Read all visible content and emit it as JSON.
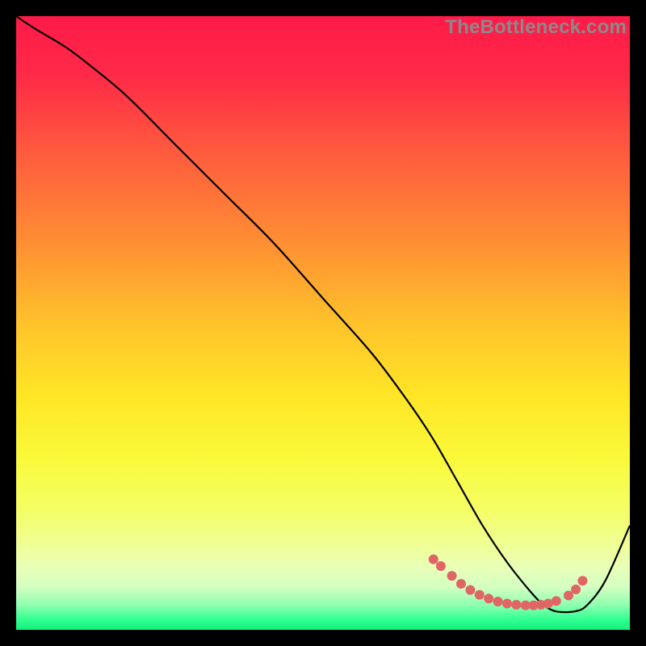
{
  "watermark": "TheBottleneck.com",
  "colors": {
    "background": "#000000",
    "gradient_stops": [
      {
        "offset": 0.0,
        "color": "#ff1a49"
      },
      {
        "offset": 0.1,
        "color": "#ff2b47"
      },
      {
        "offset": 0.22,
        "color": "#ff5a3e"
      },
      {
        "offset": 0.36,
        "color": "#ff8b34"
      },
      {
        "offset": 0.5,
        "color": "#ffc22a"
      },
      {
        "offset": 0.62,
        "color": "#ffe626"
      },
      {
        "offset": 0.72,
        "color": "#f9f93a"
      },
      {
        "offset": 0.8,
        "color": "#f5ff62"
      },
      {
        "offset": 0.86,
        "color": "#f0ff94"
      },
      {
        "offset": 0.9,
        "color": "#e8ffb9"
      },
      {
        "offset": 0.93,
        "color": "#d4ffc1"
      },
      {
        "offset": 0.96,
        "color": "#8dffaf"
      },
      {
        "offset": 0.985,
        "color": "#2bff8f"
      },
      {
        "offset": 1.0,
        "color": "#14f07e"
      }
    ],
    "curve": "#000000",
    "markers": "#e06666"
  },
  "chart_data": {
    "type": "line",
    "title": "",
    "xlabel": "",
    "ylabel": "",
    "xlim": [
      0,
      100
    ],
    "ylim": [
      0,
      100
    ],
    "series": [
      {
        "name": "bottleneck-curve",
        "x": [
          0,
          3,
          8,
          12,
          18,
          26,
          34,
          42,
          50,
          58,
          64,
          68,
          72,
          76,
          80,
          84,
          86,
          88,
          91,
          93,
          96,
          100
        ],
        "y": [
          100,
          98,
          95,
          92,
          87,
          79,
          71,
          63,
          54,
          45,
          37,
          31,
          24,
          17,
          11,
          6,
          4,
          3,
          3,
          4,
          8,
          17
        ]
      }
    ],
    "markers": {
      "name": "highlight-dots",
      "points": [
        {
          "x": 68.0,
          "y": 11.5
        },
        {
          "x": 69.2,
          "y": 10.4
        },
        {
          "x": 71.0,
          "y": 8.8
        },
        {
          "x": 72.5,
          "y": 7.5
        },
        {
          "x": 74.0,
          "y": 6.5
        },
        {
          "x": 75.5,
          "y": 5.7
        },
        {
          "x": 77.0,
          "y": 5.1
        },
        {
          "x": 78.5,
          "y": 4.6
        },
        {
          "x": 80.0,
          "y": 4.3
        },
        {
          "x": 81.5,
          "y": 4.1
        },
        {
          "x": 83.0,
          "y": 4.0
        },
        {
          "x": 84.3,
          "y": 4.0
        },
        {
          "x": 85.5,
          "y": 4.1
        },
        {
          "x": 86.7,
          "y": 4.3
        },
        {
          "x": 88.0,
          "y": 4.7
        },
        {
          "x": 90.0,
          "y": 5.6
        },
        {
          "x": 91.2,
          "y": 6.6
        },
        {
          "x": 92.3,
          "y": 8.0
        }
      ],
      "radius": 6
    }
  }
}
